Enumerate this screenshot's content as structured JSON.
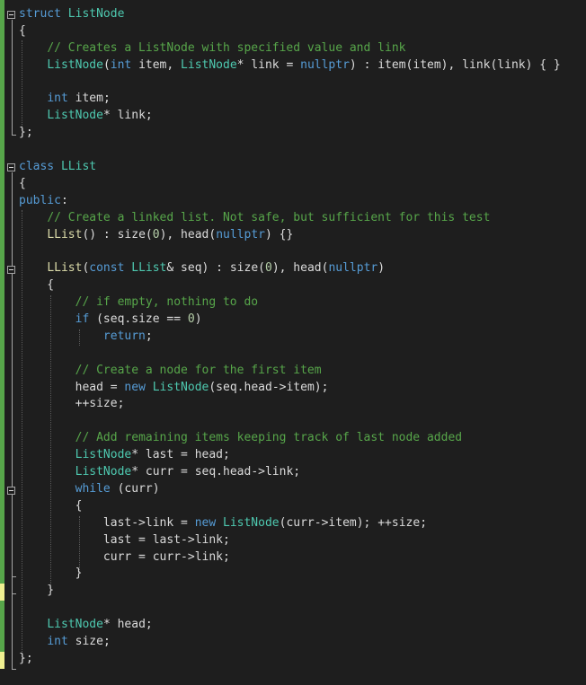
{
  "editor": {
    "colors": {
      "background": "#1e1e1e",
      "keyword": "#569cd6",
      "type": "#4ec9b0",
      "function": "#dcdcaa",
      "comment": "#57a64a",
      "number": "#b5cea8",
      "text": "#dcdcdc",
      "change_saved": "#57a64a",
      "change_unsaved": "#efef91"
    },
    "lines": [
      {
        "fold": "collapse-icon",
        "tokens": [
          [
            "kw",
            "struct"
          ],
          [
            "pl",
            " "
          ],
          [
            "ty",
            "ListNode"
          ]
        ]
      },
      {
        "tokens": [
          [
            "pl",
            "{"
          ]
        ]
      },
      {
        "tokens": [
          [
            "pl",
            "    "
          ],
          [
            "cm",
            "// Creates a ListNode with specified value and link"
          ]
        ]
      },
      {
        "tokens": [
          [
            "pl",
            "    "
          ],
          [
            "ty",
            "ListNode"
          ],
          [
            "pl",
            "("
          ],
          [
            "kw",
            "int"
          ],
          [
            "pl",
            " item, "
          ],
          [
            "ty",
            "ListNode"
          ],
          [
            "pl",
            "* link = "
          ],
          [
            "kw",
            "nullptr"
          ],
          [
            "pl",
            ") : "
          ],
          [
            "mb",
            "item"
          ],
          [
            "pl",
            "(item), "
          ],
          [
            "mb",
            "link"
          ],
          [
            "pl",
            "(link) { }"
          ]
        ]
      },
      {
        "tokens": []
      },
      {
        "tokens": [
          [
            "pl",
            "    "
          ],
          [
            "kw",
            "int"
          ],
          [
            "pl",
            " "
          ],
          [
            "mb",
            "item"
          ],
          [
            "pl",
            ";"
          ]
        ]
      },
      {
        "tokens": [
          [
            "pl",
            "    "
          ],
          [
            "ty",
            "ListNode"
          ],
          [
            "pl",
            "* "
          ],
          [
            "mb",
            "link"
          ],
          [
            "pl",
            ";"
          ]
        ]
      },
      {
        "tokens": [
          [
            "pl",
            "};"
          ]
        ]
      },
      {
        "tokens": []
      },
      {
        "fold": "collapse-icon",
        "tokens": [
          [
            "kw",
            "class"
          ],
          [
            "pl",
            " "
          ],
          [
            "ty",
            "LList"
          ]
        ]
      },
      {
        "tokens": [
          [
            "pl",
            "{"
          ]
        ]
      },
      {
        "tokens": [
          [
            "kw",
            "public"
          ],
          [
            "pl",
            ":"
          ]
        ]
      },
      {
        "tokens": [
          [
            "pl",
            "    "
          ],
          [
            "cm",
            "// Create a linked list. Not safe, but sufficient for this test"
          ]
        ]
      },
      {
        "tokens": [
          [
            "pl",
            "    "
          ],
          [
            "fn",
            "LList"
          ],
          [
            "pl",
            "() : "
          ],
          [
            "mb",
            "size"
          ],
          [
            "pl",
            "("
          ],
          [
            "nm",
            "0"
          ],
          [
            "pl",
            "), "
          ],
          [
            "mb",
            "head"
          ],
          [
            "pl",
            "("
          ],
          [
            "kw",
            "nullptr"
          ],
          [
            "pl",
            ") {}"
          ]
        ]
      },
      {
        "tokens": []
      },
      {
        "fold": "collapse-icon",
        "tokens": [
          [
            "pl",
            "    "
          ],
          [
            "fn",
            "LList"
          ],
          [
            "pl",
            "("
          ],
          [
            "kw",
            "const"
          ],
          [
            "pl",
            " "
          ],
          [
            "ty",
            "LList"
          ],
          [
            "pl",
            "& seq) : "
          ],
          [
            "mb",
            "size"
          ],
          [
            "pl",
            "("
          ],
          [
            "nm",
            "0"
          ],
          [
            "pl",
            "), "
          ],
          [
            "mb",
            "head"
          ],
          [
            "pl",
            "("
          ],
          [
            "kw",
            "nullptr"
          ],
          [
            "pl",
            ")"
          ]
        ]
      },
      {
        "tokens": [
          [
            "pl",
            "    {"
          ]
        ]
      },
      {
        "tokens": [
          [
            "pl",
            "        "
          ],
          [
            "cm",
            "// if empty, nothing to do"
          ]
        ]
      },
      {
        "tokens": [
          [
            "pl",
            "        "
          ],
          [
            "kw",
            "if"
          ],
          [
            "pl",
            " (seq."
          ],
          [
            "mb",
            "size"
          ],
          [
            "pl",
            " == "
          ],
          [
            "nm",
            "0"
          ],
          [
            "pl",
            ")"
          ]
        ]
      },
      {
        "tokens": [
          [
            "pl",
            "            "
          ],
          [
            "kw",
            "return"
          ],
          [
            "pl",
            ";"
          ]
        ]
      },
      {
        "tokens": []
      },
      {
        "tokens": [
          [
            "pl",
            "        "
          ],
          [
            "cm",
            "// Create a node for the first item"
          ]
        ]
      },
      {
        "tokens": [
          [
            "pl",
            "        "
          ],
          [
            "mb",
            "head"
          ],
          [
            "pl",
            " = "
          ],
          [
            "kw",
            "new"
          ],
          [
            "pl",
            " "
          ],
          [
            "ty",
            "ListNode"
          ],
          [
            "pl",
            "(seq."
          ],
          [
            "mb",
            "head"
          ],
          [
            "pl",
            "->"
          ],
          [
            "mb",
            "item"
          ],
          [
            "pl",
            ");"
          ]
        ]
      },
      {
        "tokens": [
          [
            "pl",
            "        ++"
          ],
          [
            "mb",
            "size"
          ],
          [
            "pl",
            ";"
          ]
        ]
      },
      {
        "tokens": []
      },
      {
        "tokens": [
          [
            "pl",
            "        "
          ],
          [
            "cm",
            "// Add remaining items keeping track of last node added"
          ]
        ]
      },
      {
        "tokens": [
          [
            "pl",
            "        "
          ],
          [
            "ty",
            "ListNode"
          ],
          [
            "pl",
            "* "
          ],
          [
            "mb",
            "last"
          ],
          [
            "pl",
            " = "
          ],
          [
            "mb",
            "head"
          ],
          [
            "pl",
            ";"
          ]
        ]
      },
      {
        "tokens": [
          [
            "pl",
            "        "
          ],
          [
            "ty",
            "ListNode"
          ],
          [
            "pl",
            "* "
          ],
          [
            "mb",
            "curr"
          ],
          [
            "pl",
            " = seq."
          ],
          [
            "mb",
            "head"
          ],
          [
            "pl",
            "->"
          ],
          [
            "mb",
            "link"
          ],
          [
            "pl",
            ";"
          ]
        ]
      },
      {
        "fold": "collapse-icon",
        "tokens": [
          [
            "pl",
            "        "
          ],
          [
            "kw",
            "while"
          ],
          [
            "pl",
            " ("
          ],
          [
            "mb",
            "curr"
          ],
          [
            "pl",
            ")"
          ]
        ]
      },
      {
        "tokens": [
          [
            "pl",
            "        {"
          ]
        ]
      },
      {
        "tokens": [
          [
            "pl",
            "            "
          ],
          [
            "mb",
            "last"
          ],
          [
            "pl",
            "->"
          ],
          [
            "mb",
            "link"
          ],
          [
            "pl",
            " = "
          ],
          [
            "kw",
            "new"
          ],
          [
            "pl",
            " "
          ],
          [
            "ty",
            "ListNode"
          ],
          [
            "pl",
            "("
          ],
          [
            "mb",
            "curr"
          ],
          [
            "pl",
            "->"
          ],
          [
            "mb",
            "item"
          ],
          [
            "pl",
            "); ++"
          ],
          [
            "mb",
            "size"
          ],
          [
            "pl",
            ";"
          ]
        ]
      },
      {
        "tokens": [
          [
            "pl",
            "            "
          ],
          [
            "mb",
            "last"
          ],
          [
            "pl",
            " = "
          ],
          [
            "mb",
            "last"
          ],
          [
            "pl",
            "->"
          ],
          [
            "mb",
            "link"
          ],
          [
            "pl",
            ";"
          ]
        ]
      },
      {
        "tokens": [
          [
            "pl",
            "            "
          ],
          [
            "mb",
            "curr"
          ],
          [
            "pl",
            " = "
          ],
          [
            "mb",
            "curr"
          ],
          [
            "pl",
            "->"
          ],
          [
            "mb",
            "link"
          ],
          [
            "pl",
            ";"
          ]
        ]
      },
      {
        "tokens": [
          [
            "pl",
            "        }"
          ]
        ]
      },
      {
        "tokens": [
          [
            "pl",
            "    }"
          ]
        ]
      },
      {
        "tokens": []
      },
      {
        "tokens": [
          [
            "pl",
            "    "
          ],
          [
            "ty",
            "ListNode"
          ],
          [
            "pl",
            "* "
          ],
          [
            "mb",
            "head"
          ],
          [
            "pl",
            ";"
          ]
        ]
      },
      {
        "tokens": [
          [
            "pl",
            "    "
          ],
          [
            "kw",
            "int"
          ],
          [
            "pl",
            " "
          ],
          [
            "mb",
            "size"
          ],
          [
            "pl",
            ";"
          ]
        ]
      },
      {
        "tokens": [
          [
            "pl",
            "};"
          ]
        ]
      }
    ]
  }
}
